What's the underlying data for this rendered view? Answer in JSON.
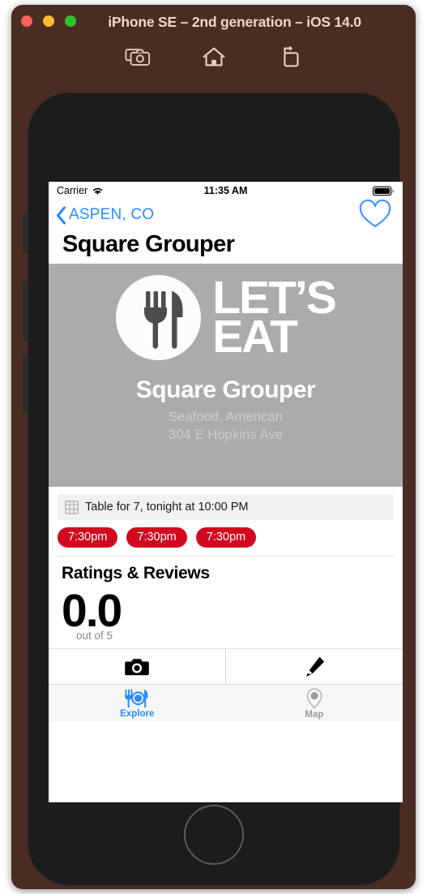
{
  "window": {
    "title": "iPhone SE – 2nd generation – iOS 14.0",
    "traffic_lights": [
      "close",
      "minimize",
      "zoom"
    ],
    "toolbar_icons": [
      "screenshot-camera-icon",
      "home-icon",
      "rotate-icon"
    ],
    "chrome_color": "#4a2c22"
  },
  "status_bar": {
    "carrier": "Carrier",
    "wifi_icon": "wifi-icon",
    "time": "11:35 AM",
    "battery_icon": "battery-icon"
  },
  "nav": {
    "back_label": "ASPEN, CO",
    "back_icon": "chevron-left-icon",
    "favorite_icon": "heart-outline-icon",
    "accent_color": "#2b8cff"
  },
  "page": {
    "title": "Square Grouper"
  },
  "hero": {
    "logo_text_line1": "LET’S",
    "logo_text_line2": "EAT",
    "logo_icon": "fork-and-knife-plate-icon",
    "name": "Square Grouper",
    "category": "Seafood, American",
    "address": "304 E Hopkins Ave",
    "background_color": "#ababab"
  },
  "reservation": {
    "icon": "calendar-grid-icon",
    "summary": "Table for 7, tonight at 10:00 PM",
    "times": [
      "7:30pm",
      "7:30pm",
      "7:30pm"
    ],
    "pill_color": "#d2091e"
  },
  "ratings": {
    "heading": "Ratings & Reviews",
    "score": "0.0",
    "out_of": "out of 5"
  },
  "actions": [
    {
      "name": "add-photo-button",
      "icon": "camera-icon"
    },
    {
      "name": "write-review-button",
      "icon": "pencil-icon"
    }
  ],
  "tabbar": {
    "tabs": [
      {
        "label": "Explore",
        "icon": "restaurant-icon",
        "active": true
      },
      {
        "label": "Map",
        "icon": "map-pin-icon",
        "active": false
      }
    ]
  }
}
